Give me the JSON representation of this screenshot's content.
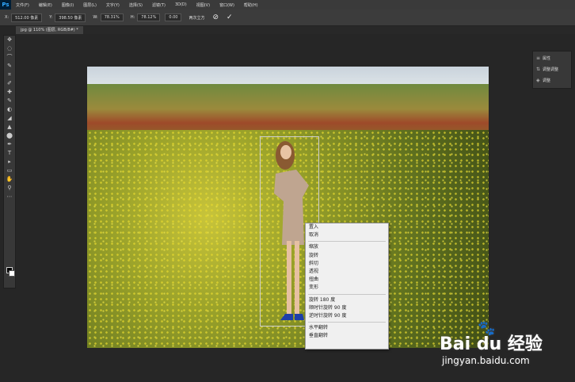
{
  "app": {
    "logo": "Ps"
  },
  "menubar": {
    "items": [
      "文件(F)",
      "编辑(E)",
      "图像(I)",
      "图层(L)",
      "文字(Y)",
      "选择(S)",
      "滤镜(T)",
      "3D(D)",
      "视图(V)",
      "窗口(W)",
      "帮助(H)"
    ]
  },
  "options": {
    "x_label": "X:",
    "x_value": "512.00 像素",
    "y_label": "Y:",
    "y_value": "398.50 像素",
    "w_label": "W:",
    "w_value": "78.31%",
    "h_label": "H:",
    "h_value": "78.12%",
    "rotate_value": "0.00",
    "interp": "两次立方",
    "cancel_icon": "⊘",
    "commit_icon": "✓"
  },
  "tab": {
    "title": "jpg @ 110% (图层, RGB/8#) *"
  },
  "tools": [
    "✥",
    "◌",
    "⌒",
    "✎",
    "⌗",
    "✐",
    "✚",
    "✎",
    "◐",
    "◢",
    "▲",
    "⬤",
    "✒",
    "T",
    "▸",
    "▭",
    "✋",
    "⚲",
    "⋯"
  ],
  "context_menu": {
    "group1": [
      "置入",
      "取消"
    ],
    "group2": [
      "缩放",
      "旋转",
      "斜切",
      "透视",
      "扭曲",
      "变形"
    ],
    "group3": [
      "旋转 180 度",
      "顺时针旋转 90 度",
      "逆时针旋转 90 度"
    ],
    "group4": [
      "水平翻转",
      "垂直翻转"
    ]
  },
  "panel": {
    "items": [
      {
        "icon": "≡",
        "label": "属性"
      },
      {
        "icon": "⇅",
        "label": "调整调整"
      },
      {
        "icon": "◈",
        "label": "调整"
      }
    ]
  },
  "watermark": {
    "brand": "Bai du 经验",
    "url": "jingyan.baidu.com",
    "paw": "🐾"
  },
  "colors": {
    "menubar": "#3a3a3a",
    "workspace": "#262626",
    "ps_blue": "#31a8ff",
    "menu_bg": "#f0f0f0"
  }
}
